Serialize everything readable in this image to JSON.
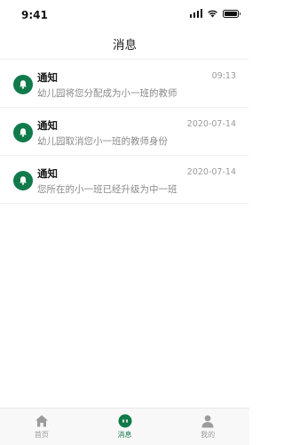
{
  "status_bar": {
    "time": "9:41"
  },
  "header": {
    "title": "消息"
  },
  "messages": [
    {
      "title": "通知",
      "time": "09:13",
      "desc": "幼儿园将您分配成为小一班的教师"
    },
    {
      "title": "通知",
      "time": "2020-07-14",
      "desc": "幼儿园取消您小一班的教师身份"
    },
    {
      "title": "通知",
      "time": "2020-07-14",
      "desc": "您所在的小一班已经升级为中一班"
    }
  ],
  "tabs": [
    {
      "label": "首页",
      "icon": "home-icon",
      "active": false
    },
    {
      "label": "消息",
      "icon": "message-icon",
      "active": true
    },
    {
      "label": "我的",
      "icon": "profile-icon",
      "active": false
    }
  ],
  "colors": {
    "accent": "#117a4a",
    "inactive": "#9b9b9b"
  }
}
